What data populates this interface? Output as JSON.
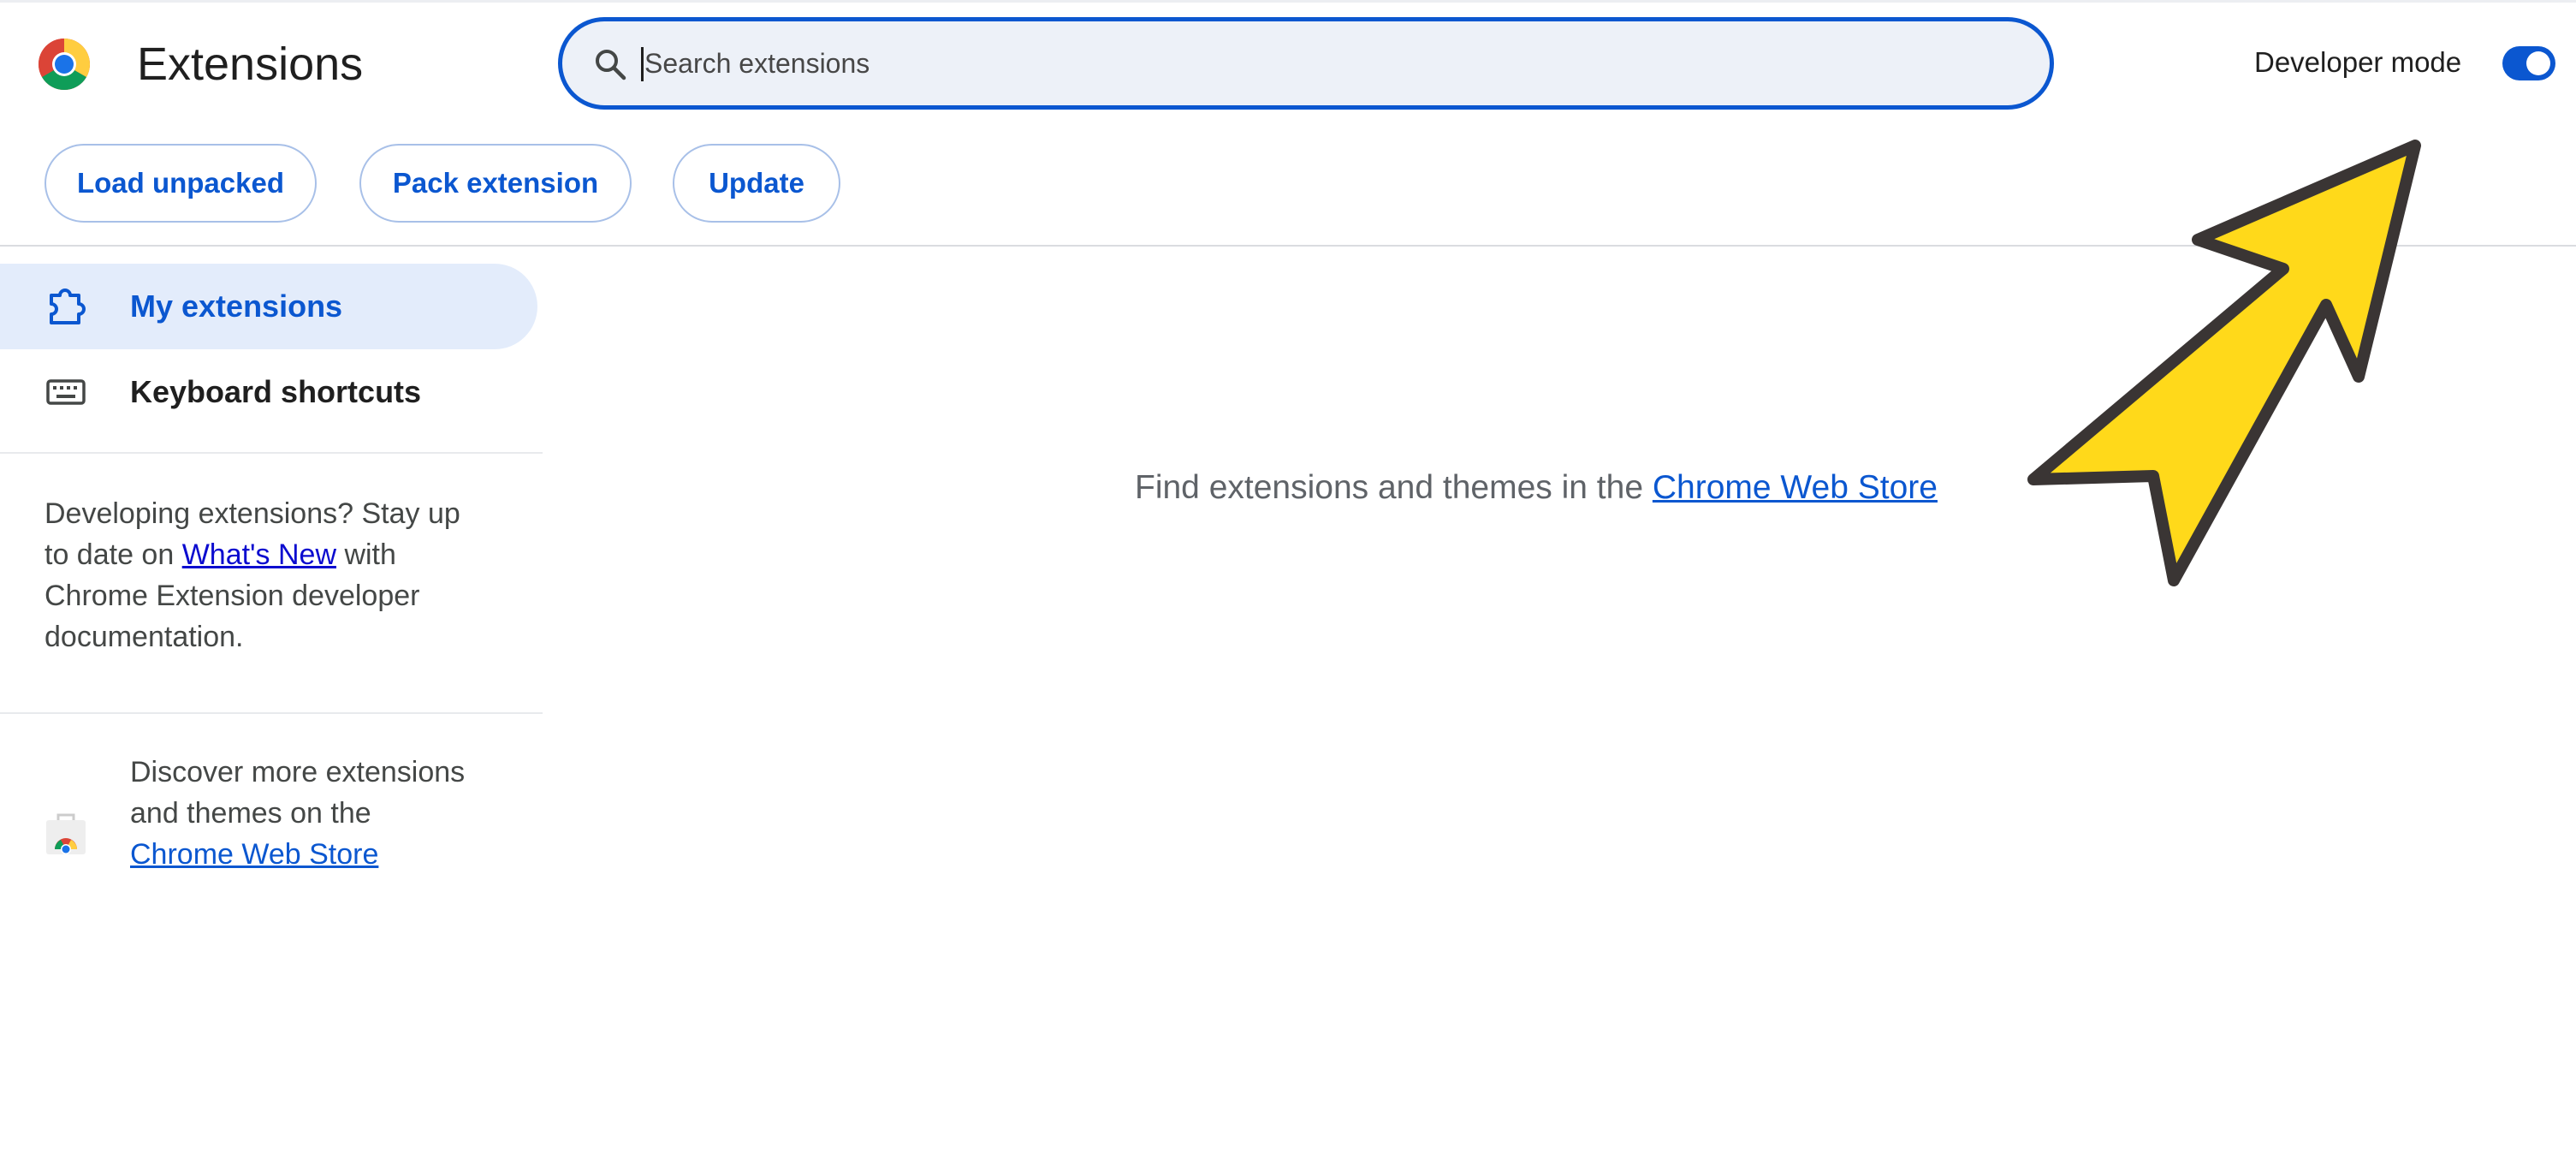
{
  "header": {
    "title": "Extensions",
    "search_placeholder": "Search extensions",
    "developer_mode_label": "Developer mode",
    "developer_mode_on": true
  },
  "toolbar": {
    "load_unpacked": "Load unpacked",
    "pack_extension": "Pack extension",
    "update": "Update"
  },
  "sidebar": {
    "items": [
      {
        "label": "My extensions",
        "icon": "puzzle-icon",
        "active": true
      },
      {
        "label": "Keyboard shortcuts",
        "icon": "keyboard-icon",
        "active": false
      }
    ],
    "dev_text": {
      "before": "Developing extensions? Stay up to date on ",
      "link": "What's New",
      "after": " with Chrome Extension developer documentation."
    },
    "discover": {
      "before": "Discover more extensions and themes on the ",
      "link": "Chrome Web Store"
    }
  },
  "main": {
    "empty_text": "Find extensions and themes in the ",
    "empty_link": "Chrome Web Store"
  },
  "colors": {
    "accent": "#0b57d0",
    "search_bg": "#edf1f8",
    "active_nav_bg": "#e3ecfb",
    "arrow_fill": "#ffd91a",
    "arrow_stroke": "#3a3534"
  },
  "annotation": {
    "icon": "arrow-pointer-icon"
  }
}
